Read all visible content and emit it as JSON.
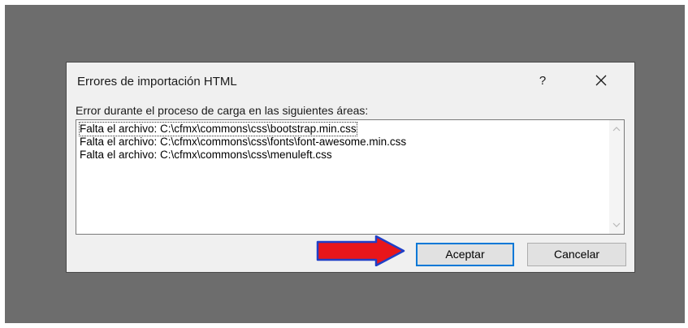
{
  "dialog": {
    "title": "Errores de importación HTML",
    "help_label": "?",
    "message": "Error durante el proceso de carga en las siguientes áreas:",
    "errors": [
      "Falta el archivo: C:\\cfmx\\commons\\css\\bootstrap.min.css",
      "Falta el archivo: C:\\cfmx\\commons\\css\\fonts\\font-awesome.min.css",
      "Falta el archivo: C:\\cfmx\\commons\\css\\menuleft.css"
    ],
    "ok_label": "Aceptar",
    "cancel_label": "Cancelar"
  },
  "icons": {
    "close": "close-icon",
    "scroll_up": "chevron-up-icon",
    "scroll_down": "chevron-down-icon",
    "annotation": "arrow-right-icon"
  },
  "colors": {
    "backdrop": "#6d6d6d",
    "dialog_bg": "#f0f0f0",
    "default_button_border": "#0078d7",
    "annotation_arrow": "#e8161b"
  }
}
